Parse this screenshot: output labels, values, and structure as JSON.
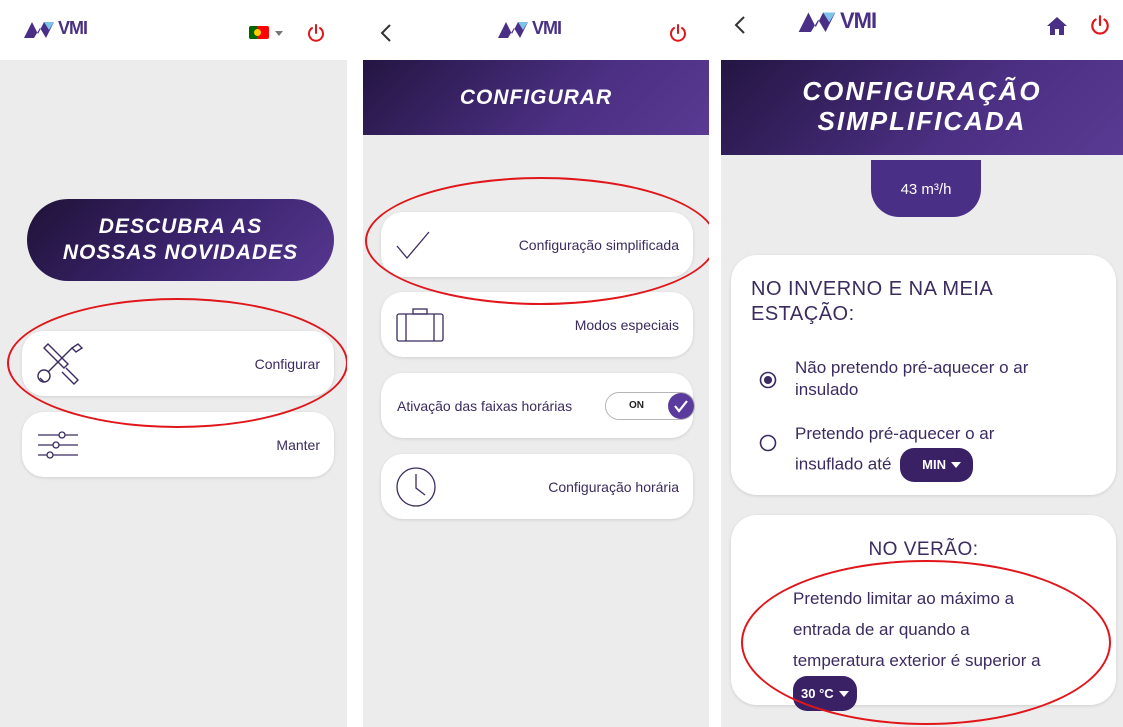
{
  "brand": {
    "logo_text": "VMI",
    "colors": {
      "primary": "#4a2f86",
      "dark": "#241542",
      "highlight": "#e0161b"
    }
  },
  "screen1": {
    "banner_line1": "DESCUBRA AS",
    "banner_line2": "NOSSAS NOVIDADES",
    "menu": [
      {
        "label": "Configurar",
        "icon": "tools-icon"
      },
      {
        "label": "Manter",
        "icon": "sliders-icon"
      }
    ]
  },
  "screen2": {
    "title": "CONFIGURAR",
    "menu": [
      {
        "label": "Configuração simplificada",
        "icon": "checkmark-icon"
      },
      {
        "label": "Modos especiais",
        "icon": "suitcase-icon"
      },
      {
        "label": "Ativação das faixas horárias",
        "icon": "toggle"
      },
      {
        "label": "Configuração horária",
        "icon": "clock-icon"
      }
    ],
    "toggle_text": "ON"
  },
  "screen3": {
    "title_line1": "CONFIGURAÇÃO",
    "title_line2": "SIMPLIFICADA",
    "airflow": "43 m³/h",
    "winter": {
      "heading_line1": "NO INVERNO E NA MEIA",
      "heading_line2": "ESTAÇÃO:",
      "option1_line1": "Não pretendo pré-aquecer o ar",
      "option1_line2": "insulado",
      "option2_line1": "Pretendo pré-aquecer o ar",
      "option2_line2": "insuflado até",
      "option2_value": "MIN"
    },
    "summer": {
      "heading": "NO VERÃO:",
      "text_line1": "Pretendo limitar ao máximo a",
      "text_line2": "entrada de ar quando a",
      "text_line3": "temperatura exterior é superior a",
      "value": "30 °C"
    }
  }
}
